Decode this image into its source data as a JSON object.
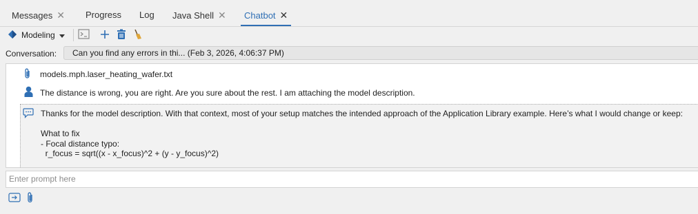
{
  "tabs": [
    {
      "label": "Messages",
      "closable": true
    },
    {
      "label": "Progress",
      "closable": false
    },
    {
      "label": "Log",
      "closable": false
    },
    {
      "label": "Java Shell",
      "closable": true
    },
    {
      "label": "Chatbot",
      "closable": true,
      "active": true
    }
  ],
  "tab_close_glyph": "✕",
  "toolbar": {
    "mode_label": "Modeling",
    "icons": [
      "modeling-icon",
      "chevron-down-icon",
      "console-icon",
      "add-icon",
      "delete-icon",
      "clear-icon"
    ]
  },
  "conversation": {
    "label": "Conversation:",
    "selected": "Can you find any errors in thi... (Feb 3, 2026, 4:06:37 PM)"
  },
  "messages": {
    "attachment": "models.mph.laser_heating_wafer.txt",
    "user": "The distance is wrong, you are right. Are you sure about the rest. I am attaching the model description.",
    "bot": "Thanks for the model description. With that context, most of your setup matches the intended approach of the Application Library example. Here’s what I would change or keep:\n\nWhat to fix\n- Focal distance typo:\n  r_focus = sqrt((x - x_focus)^2 + (y - y_focus)^2)"
  },
  "prompt": {
    "placeholder": "Enter prompt here"
  },
  "bottom_icons": [
    "send-icon",
    "attach-icon"
  ],
  "colors": {
    "accent": "#2f6fb4",
    "background": "#f0f0f0",
    "bot_bg": "#f2f2f2"
  }
}
